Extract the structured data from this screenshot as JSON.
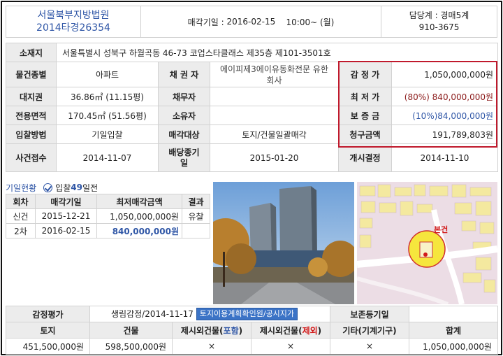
{
  "header": {
    "court": "서울북부지방법원",
    "case_no": "2014타경26354",
    "sale_date_label": "매각기일 :",
    "sale_date": "2016-02-15",
    "sale_time": "10:00~ (월)",
    "dept": "담당계 : 경매5계",
    "phone": "910-3675"
  },
  "main": {
    "address_label": "소재지",
    "address": "서울특별시 성북구 하월곡동 46-73 코업스타클래스 제35층 제101-3501호",
    "type_label": "물건종별",
    "type": "아파트",
    "creditor_label": "채 권 자",
    "creditor_line1": "에이피제3에이유동화전문 유한",
    "creditor_line2": "회사",
    "appraisal_label": "감 정 가",
    "appraisal": "1,050,000,000원",
    "land_label": "대지권",
    "land": "36.86㎡ (11.15평)",
    "debtor_label": "채무자",
    "debtor": "",
    "min_label": "최 저 가",
    "min_pct": "(80%)",
    "min_value": "840,000,000원",
    "area_label": "전용면적",
    "area": "170.45㎡ (51.56평)",
    "owner_label": "소유자",
    "owner": "",
    "deposit_label": "보 증 금",
    "deposit": "(10%)84,000,000원",
    "method_label": "입찰방법",
    "method": "기일입찰",
    "target_label": "매각대상",
    "target": "토지/건물일괄매각",
    "claim_label": "청구금액",
    "claim": "191,789,803원",
    "filed_label": "사건접수",
    "filed": "2014-11-07",
    "dividend_label_1": "배당종기",
    "dividend_label_2": "일",
    "dividend": "2015-01-20",
    "start_label": "개시결정",
    "start": "2014-11-10"
  },
  "status": {
    "link": "기일현황",
    "prefix": "입찰",
    "days": "49",
    "suffix": "일전"
  },
  "history": {
    "headers": [
      "회차",
      "매각기일",
      "최저매각금액",
      "결과"
    ],
    "rows": [
      {
        "round": "신건",
        "date": "2015-12-21",
        "price": "1,050,000,000원",
        "result": "유찰"
      },
      {
        "round": "2차",
        "date": "2016-02-15",
        "price": "840,000,000원",
        "result": ""
      }
    ]
  },
  "map": {
    "label": "본건"
  },
  "bottom": {
    "appraisal_label": "감정평가",
    "appraiser": "생림감정/2014-11-17",
    "land_use_button": "토지이용계획확인원/공시지가",
    "preservation_label": "보존등기일",
    "preservation": "",
    "headers": {
      "land": "토지",
      "building": "건물",
      "ext_inc_pre": "제시외건물(",
      "ext_inc_mid": "포함",
      "ext_exc_mid": "제외",
      "ext_post": ")",
      "other": "기타(기계기구)",
      "total": "합계"
    },
    "values": {
      "land": "451,500,000원",
      "building": "598,500,000원",
      "ext_inc": "×",
      "ext_exc": "×",
      "other": "×",
      "total": "1,050,000,000원"
    }
  },
  "colors": {
    "accent": "#2f56a6",
    "highlight": "#c0192c",
    "min_price": "#8b1a1a",
    "deposit": "#2f56a6"
  }
}
